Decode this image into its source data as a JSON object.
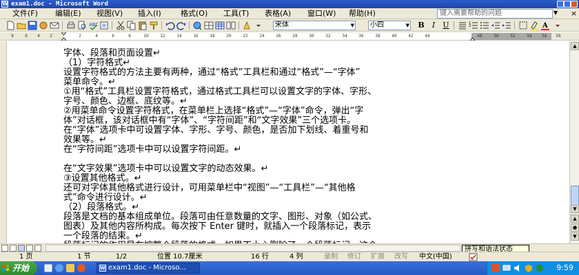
{
  "window": {
    "title": "exam1.doc - Microsoft Word"
  },
  "menubar": {
    "items": [
      "文件(F)",
      "编辑(E)",
      "视图(V)",
      "插入(I)",
      "格式(O)",
      "工具(T)",
      "表格(A)",
      "窗口(W)",
      "帮助(H)"
    ],
    "help_placeholder": "键入需要帮助的问题",
    "close_glyph": "×"
  },
  "toolbar": {
    "font_name": "宋体",
    "font_size": "小四",
    "bold": "B",
    "italic": "I",
    "underline": "U"
  },
  "ruler": {
    "numbers": [
      "8",
      "6",
      "4",
      "2",
      "2",
      "4",
      "6",
      "8",
      "10",
      "12",
      "14",
      "16",
      "18",
      "20",
      "22",
      "24",
      "26",
      "28",
      "30",
      "32",
      "34",
      "36",
      "38",
      "40",
      "42",
      "44",
      "48",
      "50",
      "52",
      "54",
      "56",
      "58"
    ]
  },
  "document": {
    "lines": [
      "字体、段落和页面设置↵",
      "（1）字符格式↵",
      "设置字符格式的方法主要有两种，通过“格式”工具栏和通过“格式”—“字体”",
      "菜单命令。↵",
      "①用“格式”工具栏设置字符格式，通过格式工具栏可以设置文字的字体、字形、",
      "字号、颜色、边框、底纹等。↵",
      "②用菜单命令设置字符格式，在菜单栏上选择“格式”—“字体”命令，弹出“字",
      "体”对话框，该对话框中有“字体”、“字符间距”和“文字效果”三个选项卡。",
      "在“字体”选项卡中可设置字体、字形、字号、颜色，是否加下划线、着重号和",
      "效果等。↵",
      "在“字符间距”选项卡中可以设置字符间距。↵",
      "",
      "在“文字效果”选项卡中可以设置文字的动态效果。↵",
      "③设置其他格式。↵",
      "还可对字体其他格式进行设计，可用菜单栏中“视图”—“工具栏”—“其他格",
      "式”命令进行设计。↵",
      "（2）段落格式。↵",
      "段落是文档的基本组成单位。段落可由任意数量的文字、图形、对象（如公式、",
      "图表）及其他内容所构成。每次按下 Enter 键时，就插入一个段落标记，表示",
      "一个段落的结束。↵",
      "段落标记的作用是在控整个段落的格式，如果不小心删除了一个段落标记，这个"
    ]
  },
  "spell_tip": "拼写和语法状态",
  "statusbar": {
    "page": "1 页",
    "section": "1 节",
    "pages": "1/2",
    "position": "位置 10.7厘米",
    "row": "16 行",
    "col": "4 列",
    "rec": "录制",
    "trk": "修订",
    "ext": "扩展",
    "ovr": "改写",
    "lang": "中文(中国)"
  },
  "taskbar": {
    "start": "开始",
    "task_label": "exam1.doc - Microso...",
    "clock": "9:59"
  }
}
